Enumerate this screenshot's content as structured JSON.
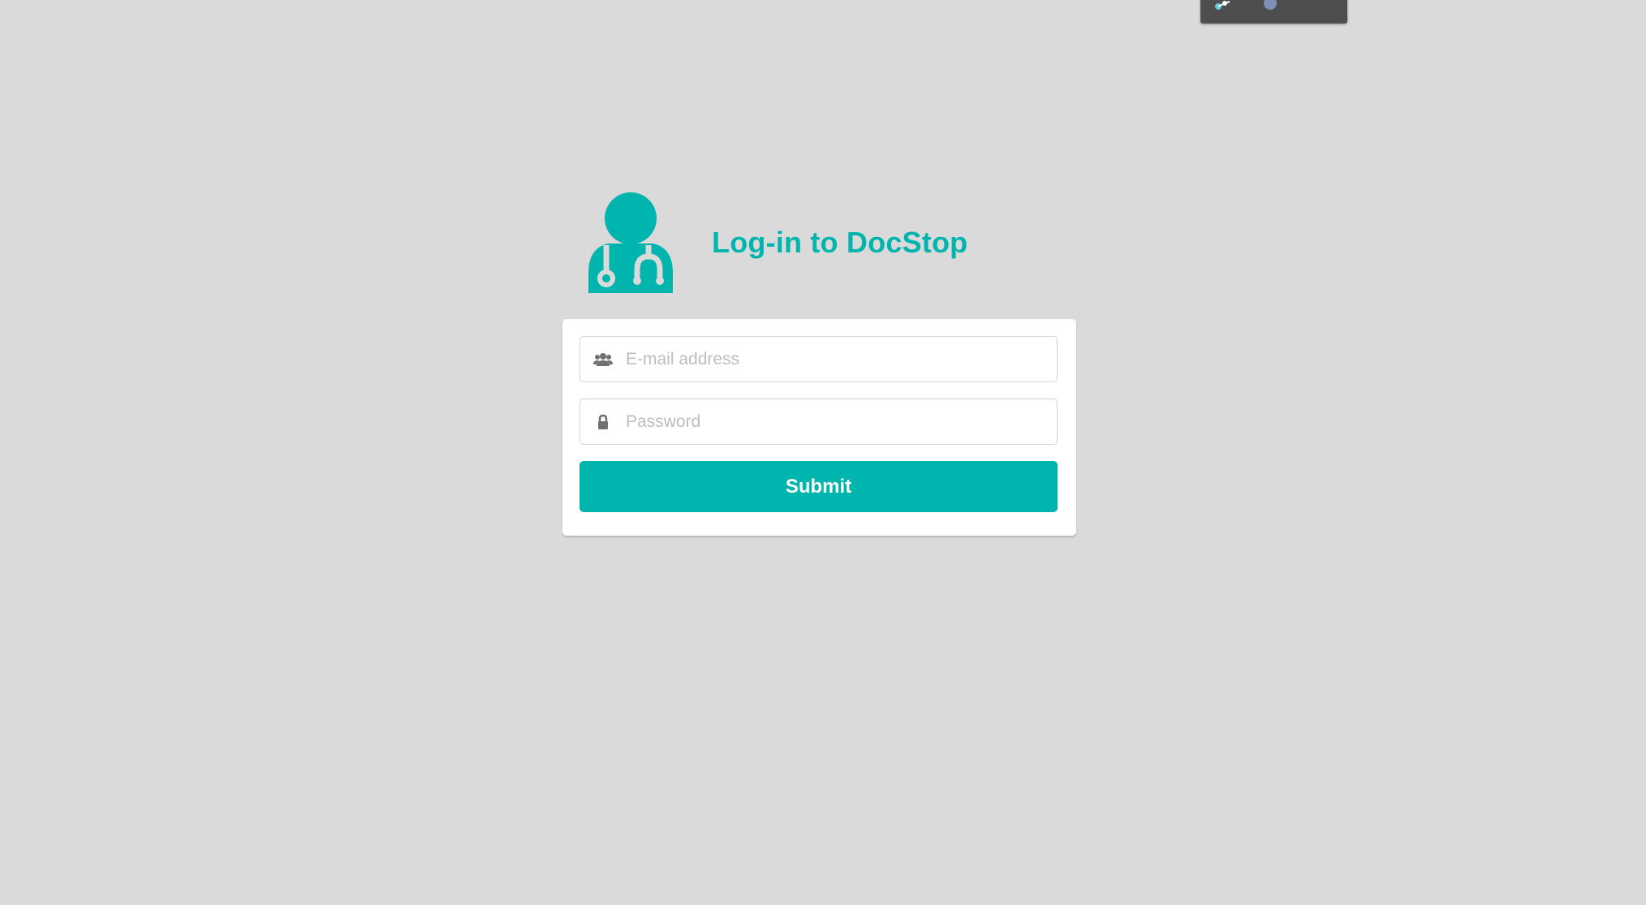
{
  "title": "Log-in to DocStop",
  "form": {
    "email": {
      "placeholder": "E-mail address",
      "value": "",
      "icon": "users-icon"
    },
    "password": {
      "placeholder": "Password",
      "value": "",
      "icon": "lock-icon"
    },
    "submit_label": "Submit"
  },
  "brand": {
    "logo_icon": "doctor-icon"
  },
  "colors": {
    "accent": "#00b5ad",
    "background": "#dadada",
    "card": "#ffffff",
    "toolbar": "#4e4e4e"
  }
}
